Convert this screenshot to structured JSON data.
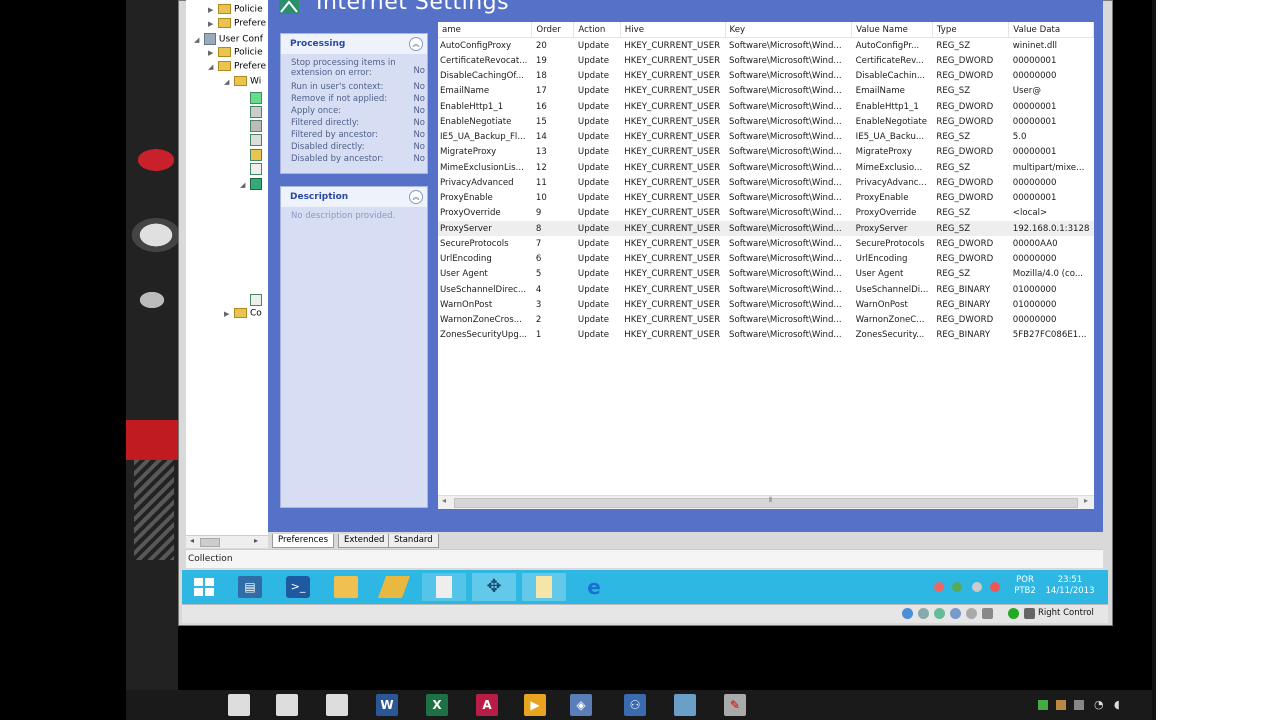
{
  "window_title": "Internet Settings",
  "tree": [
    {
      "label": "Policie",
      "indent": 1
    },
    {
      "label": "Prefere",
      "indent": 1
    },
    {
      "label": "User Conf",
      "indent": 0
    },
    {
      "label": "Policie",
      "indent": 1
    },
    {
      "label": "Prefere",
      "indent": 1
    },
    {
      "label": "Wi",
      "indent": 2
    }
  ],
  "tree_bottom_label": "Co",
  "processing": {
    "header": "Processing",
    "rows": [
      {
        "label": "Stop processing items in extension on error:",
        "value": "No"
      },
      {
        "label": "Run in user's context:",
        "value": "No"
      },
      {
        "label": "Remove if not applied:",
        "value": "No"
      },
      {
        "label": "Apply once:",
        "value": "No"
      },
      {
        "label": "Filtered directly:",
        "value": "No"
      },
      {
        "label": "Filtered by ancestor:",
        "value": "No"
      },
      {
        "label": "Disabled directly:",
        "value": "No"
      },
      {
        "label": "Disabled by ancestor:",
        "value": "No"
      }
    ]
  },
  "description": {
    "header": "Description",
    "text": "No description provided."
  },
  "table": {
    "columns": [
      "ame",
      "Order",
      "Action",
      "Hive",
      "Key",
      "Value Name",
      "Type",
      "Value Data"
    ],
    "rows": [
      [
        "AutoConfigProxy",
        "20",
        "Update",
        "HKEY_CURRENT_USER",
        "Software\\Microsoft\\Wind...",
        "AutoConfigPr...",
        "REG_SZ",
        "wininet.dll"
      ],
      [
        "CertificateRevocat...",
        "19",
        "Update",
        "HKEY_CURRENT_USER",
        "Software\\Microsoft\\Wind...",
        "CertificateRev...",
        "REG_DWORD",
        "00000001"
      ],
      [
        "DisableCachingOf...",
        "18",
        "Update",
        "HKEY_CURRENT_USER",
        "Software\\Microsoft\\Wind...",
        "DisableCachin...",
        "REG_DWORD",
        "00000000"
      ],
      [
        "EmailName",
        "17",
        "Update",
        "HKEY_CURRENT_USER",
        "Software\\Microsoft\\Wind...",
        "EmailName",
        "REG_SZ",
        "User@"
      ],
      [
        "EnableHttp1_1",
        "16",
        "Update",
        "HKEY_CURRENT_USER",
        "Software\\Microsoft\\Wind...",
        "EnableHttp1_1",
        "REG_DWORD",
        "00000001"
      ],
      [
        "EnableNegotiate",
        "15",
        "Update",
        "HKEY_CURRENT_USER",
        "Software\\Microsoft\\Wind...",
        "EnableNegotiate",
        "REG_DWORD",
        "00000001"
      ],
      [
        "IE5_UA_Backup_Fl...",
        "14",
        "Update",
        "HKEY_CURRENT_USER",
        "Software\\Microsoft\\Wind...",
        "IE5_UA_Backu...",
        "REG_SZ",
        "5.0"
      ],
      [
        "MigrateProxy",
        "13",
        "Update",
        "HKEY_CURRENT_USER",
        "Software\\Microsoft\\Wind...",
        "MigrateProxy",
        "REG_DWORD",
        "00000001"
      ],
      [
        "MimeExclusionLis...",
        "12",
        "Update",
        "HKEY_CURRENT_USER",
        "Software\\Microsoft\\Wind...",
        "MimeExclusio...",
        "REG_SZ",
        "multipart/mixe..."
      ],
      [
        "PrivacyAdvanced",
        "11",
        "Update",
        "HKEY_CURRENT_USER",
        "Software\\Microsoft\\Wind...",
        "PrivacyAdvanc...",
        "REG_DWORD",
        "00000000"
      ],
      [
        "ProxyEnable",
        "10",
        "Update",
        "HKEY_CURRENT_USER",
        "Software\\Microsoft\\Wind...",
        "ProxyEnable",
        "REG_DWORD",
        "00000001"
      ],
      [
        "ProxyOverride",
        "9",
        "Update",
        "HKEY_CURRENT_USER",
        "Software\\Microsoft\\Wind...",
        "ProxyOverride",
        "REG_SZ",
        "<local>"
      ],
      [
        "ProxyServer",
        "8",
        "Update",
        "HKEY_CURRENT_USER",
        "Software\\Microsoft\\Wind...",
        "ProxyServer",
        "REG_SZ",
        "192.168.0.1:3128"
      ],
      [
        "SecureProtocols",
        "7",
        "Update",
        "HKEY_CURRENT_USER",
        "Software\\Microsoft\\Wind...",
        "SecureProtocols",
        "REG_DWORD",
        "00000AA0"
      ],
      [
        "UrlEncoding",
        "6",
        "Update",
        "HKEY_CURRENT_USER",
        "Software\\Microsoft\\Wind...",
        "UrlEncoding",
        "REG_DWORD",
        "00000000"
      ],
      [
        "User Agent",
        "5",
        "Update",
        "HKEY_CURRENT_USER",
        "Software\\Microsoft\\Wind...",
        "User Agent",
        "REG_SZ",
        "Mozilla/4.0 (co..."
      ],
      [
        "UseSchannelDirec...",
        "4",
        "Update",
        "HKEY_CURRENT_USER",
        "Software\\Microsoft\\Wind...",
        "UseSchannelDi...",
        "REG_BINARY",
        "01000000"
      ],
      [
        "WarnOnPost",
        "3",
        "Update",
        "HKEY_CURRENT_USER",
        "Software\\Microsoft\\Wind...",
        "WarnOnPost",
        "REG_BINARY",
        "01000000"
      ],
      [
        "WarnonZoneCros...",
        "2",
        "Update",
        "HKEY_CURRENT_USER",
        "Software\\Microsoft\\Wind...",
        "WarnonZoneC...",
        "REG_DWORD",
        "00000000"
      ],
      [
        "ZonesSecurityUpg...",
        "1",
        "Update",
        "HKEY_CURRENT_USER",
        "Software\\Microsoft\\Wind...",
        "ZonesSecurity...",
        "REG_BINARY",
        "5FB27FC086E1..."
      ]
    ],
    "selected_row": 12
  },
  "tabs": [
    "Preferences",
    "Extended",
    "Standard"
  ],
  "status_text": "Collection",
  "clock": {
    "lang": "POR",
    "layout": "PTB2",
    "time": "23:51",
    "date": "14/11/2013"
  },
  "right_control": "Right Control",
  "colors": {
    "editor_bg": "#5572c8",
    "panel_bg": "#d7def3",
    "panel_header": "#2a49a6",
    "guest_taskbar": "#2fb7e4"
  },
  "guest_taskbar_icons": [
    "windows-start-icon",
    "server-manager-icon",
    "powershell-icon",
    "file-explorer-icon",
    "folder-tool-icon",
    "notepad-icon",
    "group-policy-icon",
    "document-icon",
    "internet-explorer-icon"
  ],
  "host_taskbar_icons": [
    "window-icon",
    "window-icon",
    "window-icon",
    "word-icon",
    "excel-icon",
    "acrobat-icon",
    "media-player-icon",
    "virtualbox-icon",
    "network-icon",
    "document-icon",
    "tool-icon"
  ]
}
